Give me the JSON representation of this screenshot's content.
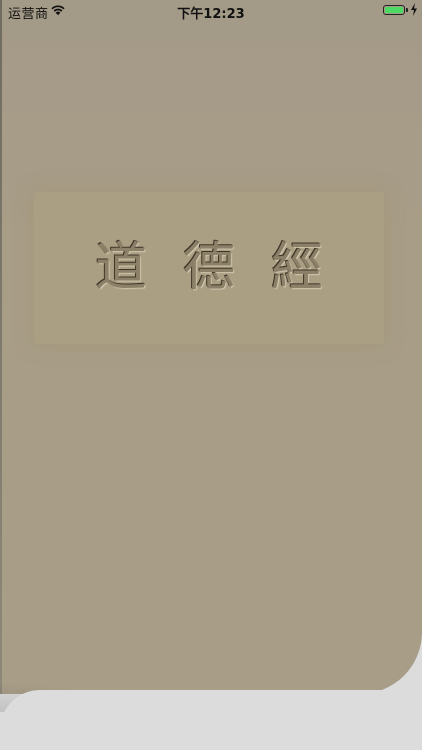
{
  "status_bar": {
    "carrier": "运营商",
    "time": "下午12:23",
    "wifi_icon": "wifi-icon",
    "battery_icon": "battery-icon",
    "charging_icon": "charging-bolt-icon",
    "battery_color": "#4cd964"
  },
  "main": {
    "title_chars": [
      "道",
      "德",
      "經"
    ]
  },
  "colors": {
    "page_background": "#a89d87",
    "panel_background": "#ab9f83",
    "bottom_background": "#dcdcdc"
  }
}
